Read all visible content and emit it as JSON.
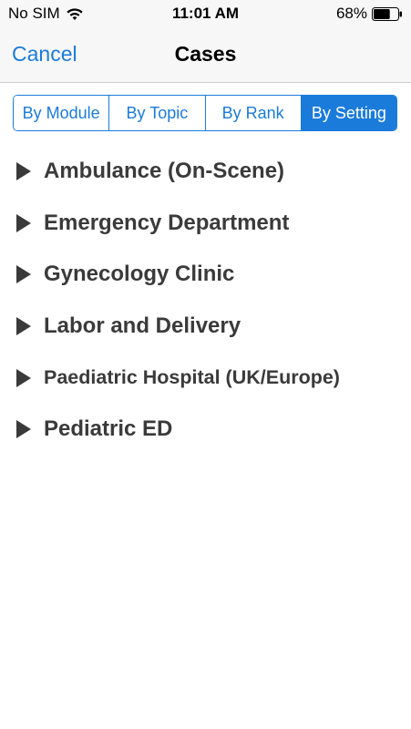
{
  "status_bar": {
    "carrier": "No SIM",
    "time": "11:01 AM",
    "battery": "68%",
    "battery_level": 0.68,
    "icons": [
      "wifi-icon",
      "battery-icon"
    ]
  },
  "nav": {
    "cancel_label": "Cancel",
    "title": "Cases"
  },
  "segments": [
    "By Module",
    "By Topic",
    "By Rank",
    "By Setting"
  ],
  "selected_segment": "By Setting",
  "list": [
    "Ambulance (On-Scene)",
    "Emergency Department",
    "Gynecology Clinic",
    "Labor and Delivery",
    "Paediatric Hospital (UK/Europe)",
    "Pediatric ED"
  ],
  "colors": {
    "accent": "#1a7bdb",
    "list_text": "#3a3a3a",
    "bar_background": "#f7f7f7"
  }
}
